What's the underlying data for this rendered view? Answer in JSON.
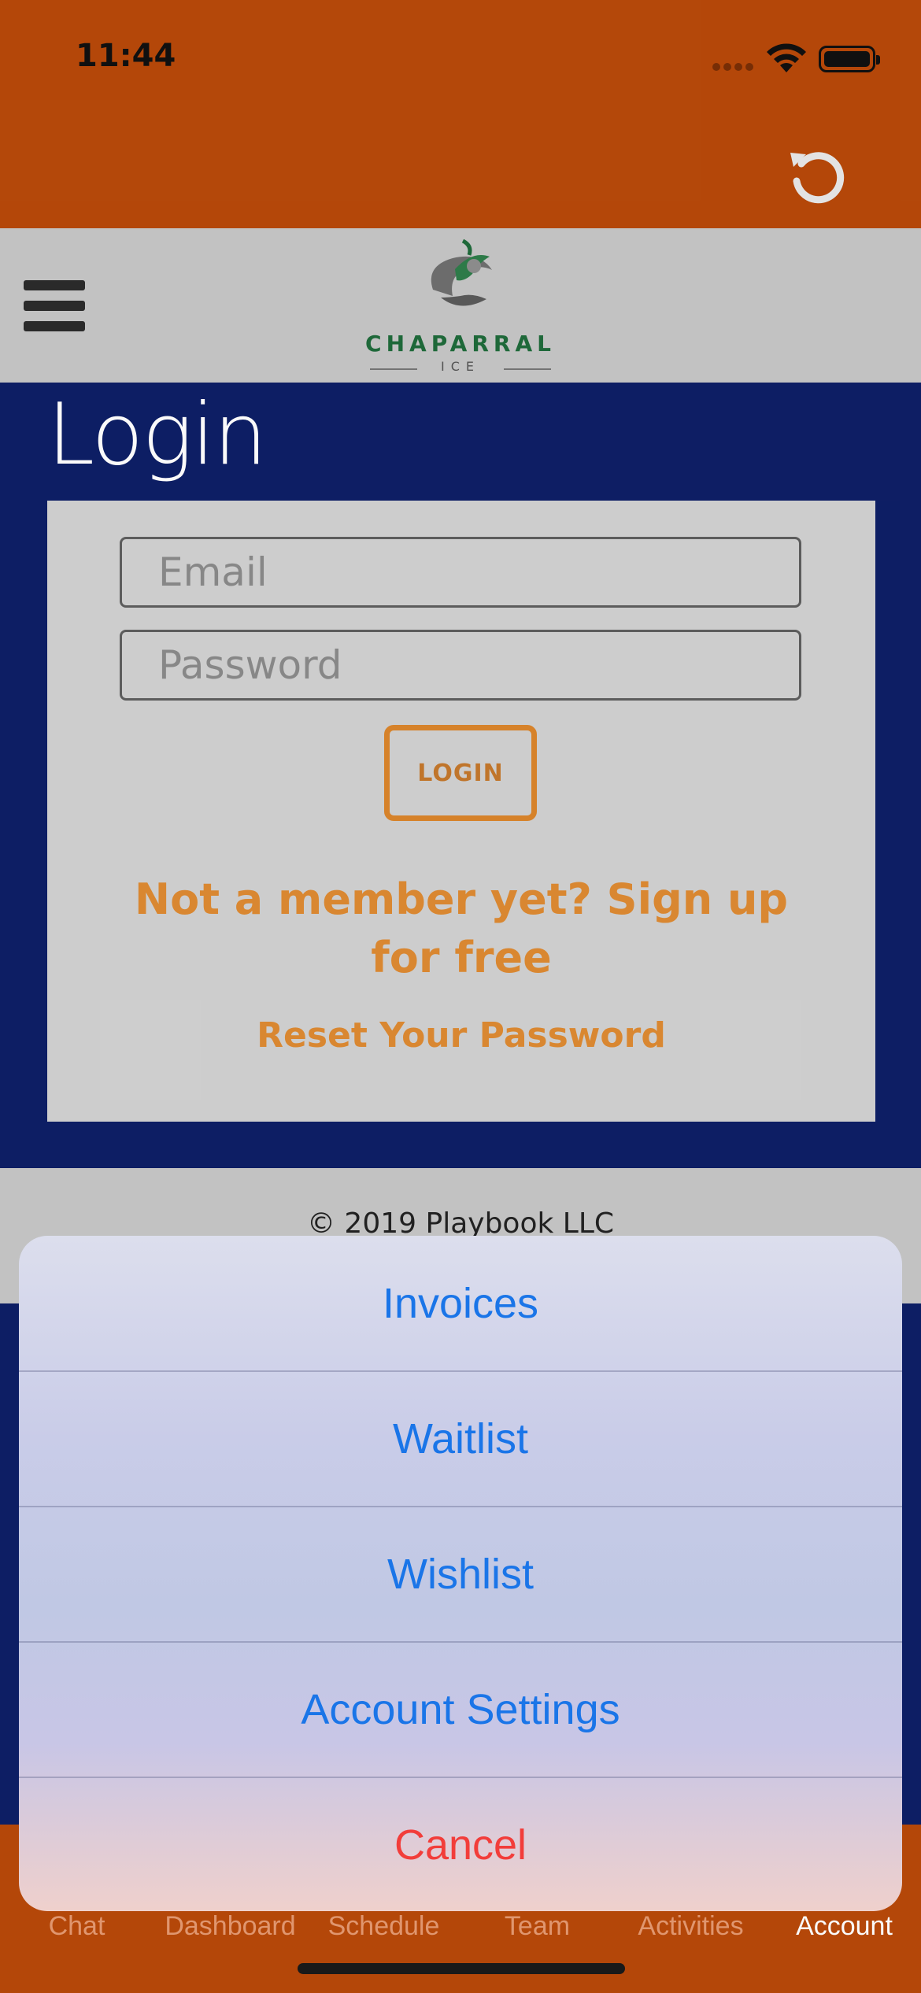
{
  "status_bar": {
    "time": "11:44"
  },
  "header": {
    "logo_name": "CHAPARRAL",
    "logo_sub": "ICE"
  },
  "login": {
    "title": "Login",
    "email_placeholder": "Email",
    "password_placeholder": "Password",
    "login_button": "LOGIN",
    "signup_link": "Not a member yet? Sign up for free",
    "reset_link": "Reset Your Password"
  },
  "footer": {
    "copyright": "© 2019 Playbook LLC"
  },
  "action_sheet": {
    "items": [
      "Invoices",
      "Waitlist",
      "Wishlist",
      "Account Settings"
    ],
    "cancel": "Cancel"
  },
  "tabbar": {
    "tabs": [
      "Chat",
      "Dashboard",
      "Schedule",
      "Team",
      "Activities",
      "Account"
    ],
    "active": "Account"
  },
  "colors": {
    "app_bar": "#b8490a",
    "page_background": "#0e1f66",
    "accent_orange": "#de8a32",
    "ios_blue": "#1a75e8",
    "ios_red": "#f23d3a"
  }
}
